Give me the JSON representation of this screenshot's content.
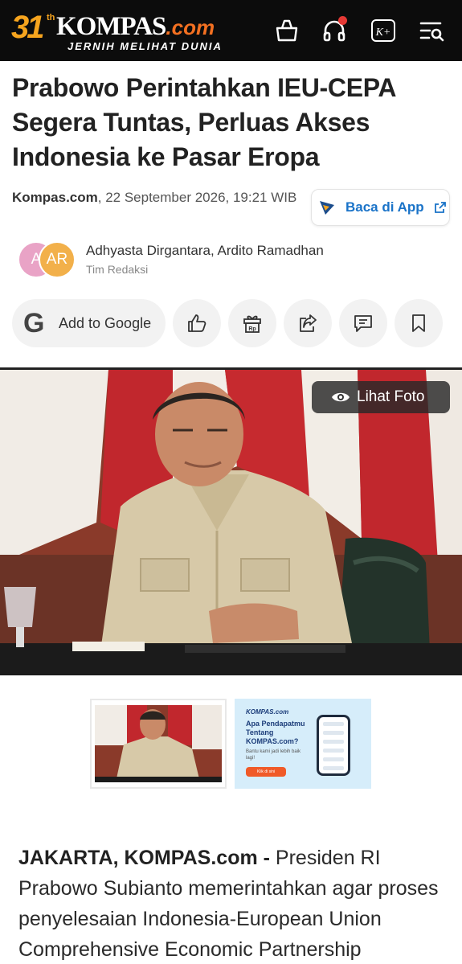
{
  "header": {
    "logo_number": "31",
    "logo_superscript": "th",
    "logo_brand": "KOMPAS",
    "logo_suffix": ".com",
    "logo_tagline": "JERNIH MELIHAT DUNIA",
    "icons": [
      "shopping-bag-icon",
      "headphones-icon",
      "kompas-plus-icon",
      "menu-search-icon"
    ],
    "kplus_label": "K+"
  },
  "article": {
    "title": "Prabowo Perintahkan IEU-CEPA Segera Tuntas, Perluas Akses Indonesia ke Pasar Eropa",
    "source": "Kompas.com",
    "datetime": ", 22 September 2026, 19:21 WIB",
    "app_button_label": "Baca di App",
    "authors": "Adhyasta Dirgantara,  Ardito Ramadhan",
    "author_role": "Tim Redaksi",
    "avatar_1": "A",
    "avatar_2": "AR",
    "google_button_label": "Add to Google",
    "google_glyph": "G",
    "actions": [
      "like-icon",
      "gift-icon",
      "share-icon",
      "comment-icon",
      "bookmark-icon"
    ],
    "gift_label": "Rp",
    "photo_button_label": "Lihat Foto",
    "ad": {
      "brand": "KOMPAS.com",
      "headline": "Apa Pendapatmu Tentang KOMPAS.com?",
      "sub": "Bantu kami jadi lebih baik lagi!",
      "cta": "Klik di sini"
    },
    "lead_dateline": "JAKARTA, KOMPAS.com - ",
    "lead_text": "Presiden RI Prabowo Subianto memerintahkan agar proses penyelesaian Indonesia-European Union Comprehensive Economic Partnership"
  },
  "colors": {
    "header_bg": "#0c0c0c",
    "logo_orange": "#f6a41e",
    "link_blue": "#1a73c8",
    "notification_red": "#e53935"
  }
}
